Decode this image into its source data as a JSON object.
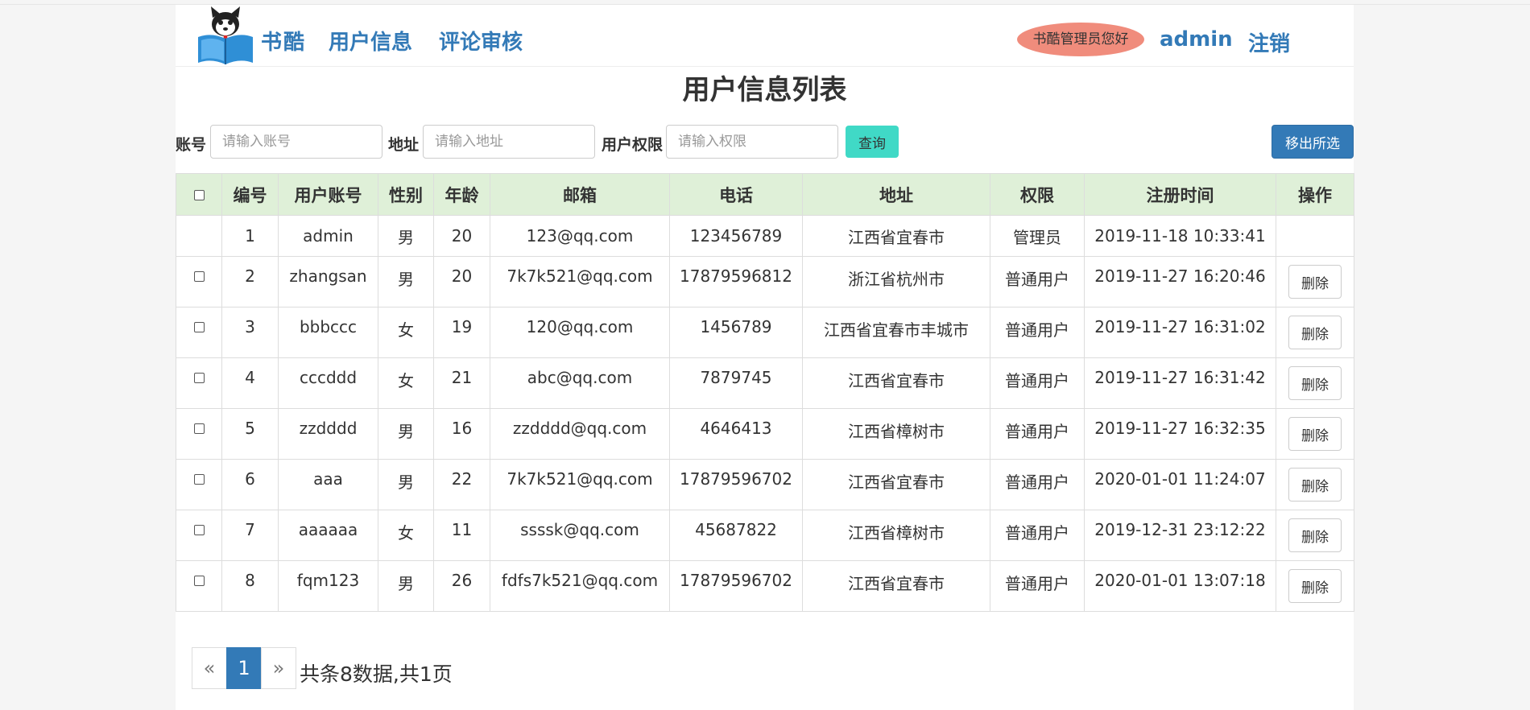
{
  "header": {
    "brand": "书酷",
    "nav": [
      "用户信息",
      "评论审核"
    ],
    "greeting": "书酷管理员您好",
    "username": "admin",
    "logout": "注销"
  },
  "page_title": "用户信息列表",
  "search": {
    "account_label": "账号",
    "account_placeholder": "请输入账号",
    "address_label": "地址",
    "address_placeholder": "请输入地址",
    "role_label": "用户权限",
    "role_placeholder": "请输入权限",
    "query_button": "查询",
    "remove_selected_button": "移出所选"
  },
  "table": {
    "headers": [
      "编号",
      "用户账号",
      "性别",
      "年龄",
      "邮箱",
      "电话",
      "地址",
      "权限",
      "注册时间",
      "操作"
    ],
    "delete_label": "删除",
    "rows": [
      {
        "id": "1",
        "account": "admin",
        "gender": "男",
        "age": "20",
        "email": "123@qq.com",
        "phone": "123456789",
        "address": "江西省宜春市",
        "role": "管理员",
        "registered": "2019-11-18 10:33:41"
      },
      {
        "id": "2",
        "account": "zhangsan",
        "gender": "男",
        "age": "20",
        "email": "7k7k521@qq.com",
        "phone": "17879596812",
        "address": "浙江省杭州市",
        "role": "普通用户",
        "registered": "2019-11-27 16:20:46"
      },
      {
        "id": "3",
        "account": "bbbccc",
        "gender": "女",
        "age": "19",
        "email": "120@qq.com",
        "phone": "1456789",
        "address": "江西省宜春市丰城市",
        "role": "普通用户",
        "registered": "2019-11-27 16:31:02"
      },
      {
        "id": "4",
        "account": "cccddd",
        "gender": "女",
        "age": "21",
        "email": "abc@qq.com",
        "phone": "7879745",
        "address": "江西省宜春市",
        "role": "普通用户",
        "registered": "2019-11-27 16:31:42"
      },
      {
        "id": "5",
        "account": "zzdddd",
        "gender": "男",
        "age": "16",
        "email": "zzdddd@qq.com",
        "phone": "4646413",
        "address": "江西省樟树市",
        "role": "普通用户",
        "registered": "2019-11-27 16:32:35"
      },
      {
        "id": "6",
        "account": "aaa",
        "gender": "男",
        "age": "22",
        "email": "7k7k521@qq.com",
        "phone": "17879596702",
        "address": "江西省宜春市",
        "role": "普通用户",
        "registered": "2020-01-01 11:24:07"
      },
      {
        "id": "7",
        "account": "aaaaaa",
        "gender": "女",
        "age": "11",
        "email": "ssssk@qq.com",
        "phone": "45687822",
        "address": "江西省樟树市",
        "role": "普通用户",
        "registered": "2019-12-31 23:12:22"
      },
      {
        "id": "8",
        "account": "fqm123",
        "gender": "男",
        "age": "26",
        "email": "fdfs7k521@qq.com",
        "phone": "17879596702",
        "address": "江西省宜春市",
        "role": "普通用户",
        "registered": "2020-01-01 13:07:18"
      }
    ]
  },
  "pagination": {
    "prev": "«",
    "current": "1",
    "next": "»",
    "info": "共条8数据,共1页"
  }
}
